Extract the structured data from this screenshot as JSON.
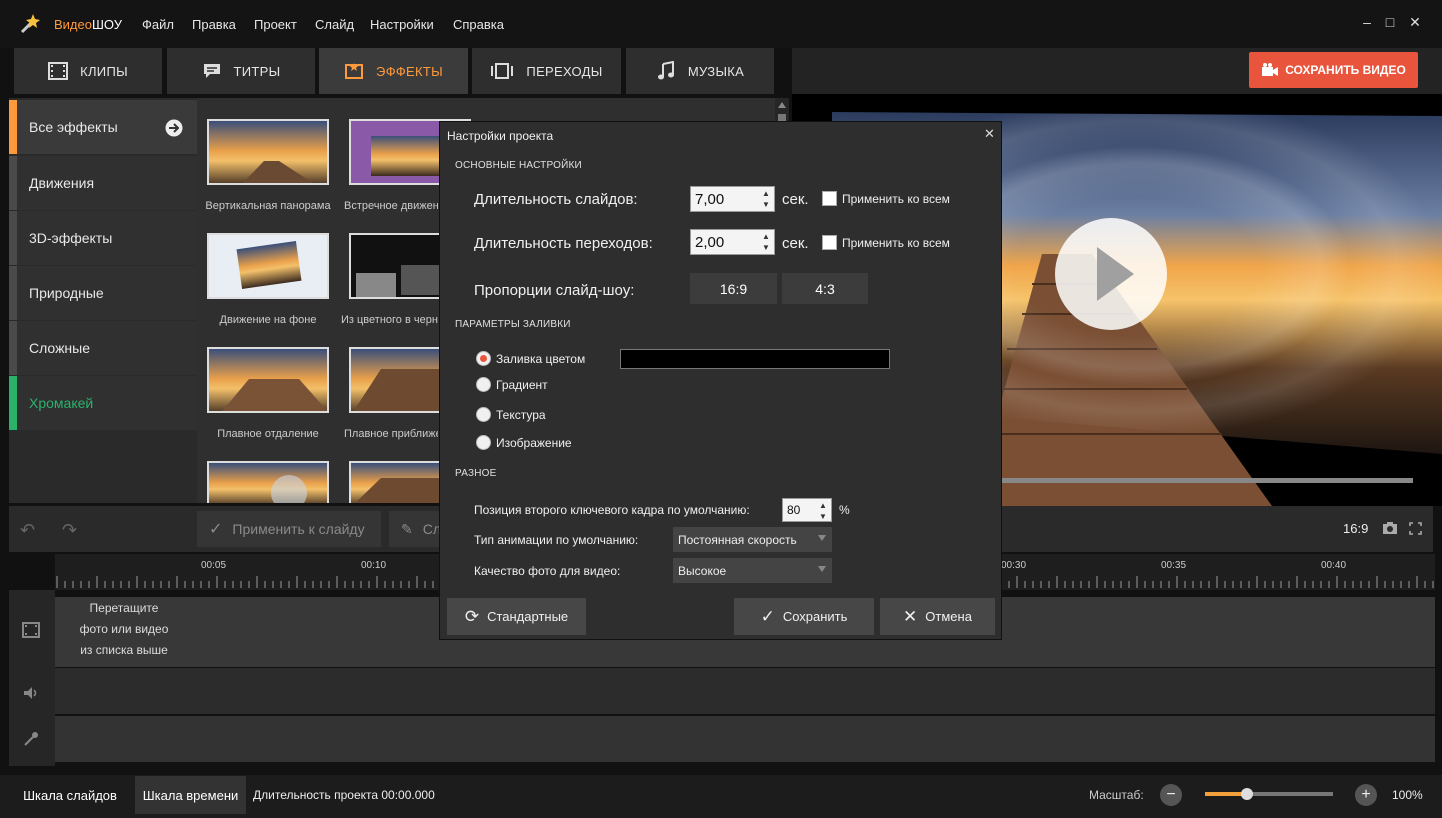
{
  "app": {
    "title_part1": "Видео",
    "title_part2": "ШОУ"
  },
  "menu": [
    "Файл",
    "Правка",
    "Проект",
    "Слайд",
    "Настройки",
    "Справка"
  ],
  "window_controls": {
    "minimize": "–",
    "maximize": "□",
    "close": "✕"
  },
  "tabs": [
    {
      "label": "КЛИПЫ",
      "icon": "film-icon",
      "active": false
    },
    {
      "label": "ТИТРЫ",
      "icon": "speech-bubble-icon",
      "active": false
    },
    {
      "label": "ЭФФЕКТЫ",
      "icon": "effects-icon",
      "active": true
    },
    {
      "label": "ПЕРЕХОДЫ",
      "icon": "transitions-icon",
      "active": false
    },
    {
      "label": "МУЗЫКА",
      "icon": "music-note-icon",
      "active": false
    }
  ],
  "save_video_label": "СОХРАНИТЬ ВИДЕО",
  "categories": [
    {
      "label": "Все эффекты",
      "active": true
    },
    {
      "label": "Движения"
    },
    {
      "label": "3D-эффекты"
    },
    {
      "label": "Природные"
    },
    {
      "label": "Сложные"
    },
    {
      "label": "Хромакей",
      "color": "#2bb26a"
    }
  ],
  "effects": [
    {
      "label": "Вертикальная панорама"
    },
    {
      "label": "Встречное движение"
    },
    {
      "label": "Движение на фоне"
    },
    {
      "label": "Из цветного в черно-белое"
    },
    {
      "label": "Плавное отдаление"
    },
    {
      "label": "Плавное приближение"
    }
  ],
  "toolbar": {
    "apply_to_slide": "Применить к слайду",
    "second_partial": "Сл",
    "aspect": "16:9"
  },
  "timeline": {
    "ruler_labels": [
      "00:05",
      "00:10",
      "00:30",
      "00:35",
      "00:40"
    ],
    "drop_hint": [
      "Перетащите",
      "фото или видео",
      "из списка выше"
    ]
  },
  "status": {
    "slides_scale": "Шкала слайдов",
    "time_scale": "Шкала времени",
    "duration": "Длительность проекта 00:00.000",
    "zoom_label": "Масштаб:",
    "zoom_value": "100%",
    "zoom_level_percent": 33
  },
  "dialog": {
    "title": "Настройки проекта",
    "close": "✕",
    "section_main": "ОСНОВНЫЕ НАСТРОЙКИ",
    "slide_duration_label": "Длительность слайдов:",
    "slide_duration_value": "7,00",
    "transition_duration_label": "Длительность переходов:",
    "transition_duration_value": "2,00",
    "unit_sec": "сек.",
    "apply_all": "Применить ко всем",
    "aspect_label": "Пропорции слайд-шоу:",
    "aspect_options": [
      "16:9",
      "4:3"
    ],
    "section_fill": "ПАРАМЕТРЫ ЗАЛИВКИ",
    "fill_options": [
      {
        "label": "Заливка цветом",
        "selected": true
      },
      {
        "label": "Градиент",
        "selected": false
      },
      {
        "label": "Текстура",
        "selected": false
      },
      {
        "label": "Изображение",
        "selected": false
      }
    ],
    "fill_color": "#000000",
    "section_misc": "РАЗНОЕ",
    "keyframe_label": "Позиция второго ключевого кадра по умолчанию:",
    "keyframe_value": "80",
    "percent": "%",
    "anim_label": "Тип анимации по умолчанию:",
    "anim_value": "Постоянная скорость",
    "quality_label": "Качество фото для видео:",
    "quality_value": "Высокое",
    "defaults_button": "Стандартные",
    "save_button": "Сохранить",
    "cancel_button": "Отмена"
  },
  "colors": {
    "accent": "#ff9a3c",
    "save_red": "#e8553c",
    "chroma_green": "#2bb26a"
  }
}
